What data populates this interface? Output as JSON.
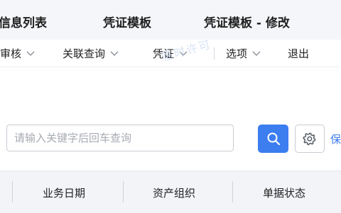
{
  "tabs": [
    "信息列表",
    "凭证模板",
    "凭证模板 - 修改"
  ],
  "toolbar": {
    "items": [
      {
        "label": "审核",
        "has_dropdown": true
      },
      {
        "label": "关联查询",
        "has_dropdown": true
      },
      {
        "label": "凭证",
        "has_dropdown": true
      },
      {
        "label": "选项",
        "has_dropdown": true
      },
      {
        "label": "退出",
        "has_dropdown": false
      }
    ]
  },
  "watermark": "临时许可",
  "search": {
    "placeholder": "请输入关键字后回车查询",
    "value": "",
    "button_icon": "search-icon",
    "settings_icon": "gear-icon",
    "save_label": "保"
  },
  "table": {
    "headers": [
      "业务日期",
      "资产组织",
      "单据状态"
    ]
  },
  "colors": {
    "accent": "#3c7df0",
    "tab_bar_bg": "#f4f6f9",
    "header_bg": "#f2f4f7"
  }
}
